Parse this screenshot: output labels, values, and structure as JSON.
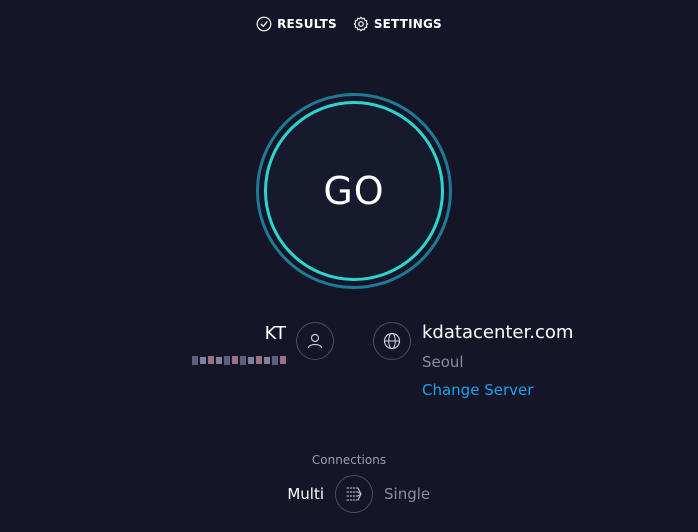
{
  "nav": {
    "results_label": "RESULTS",
    "settings_label": "SETTINGS"
  },
  "go_button": {
    "label": "GO"
  },
  "isp": {
    "name": "KT"
  },
  "server": {
    "name": "kdatacenter.com",
    "city": "Seoul",
    "change_label": "Change Server"
  },
  "connections": {
    "title": "Connections",
    "multi_label": "Multi",
    "single_label": "Single"
  },
  "icons": {
    "results": "check-circle-icon",
    "settings": "gear-icon",
    "user": "user-icon",
    "globe": "globe-icon",
    "connections": "connections-icon"
  },
  "colors": {
    "background": "#141526",
    "go_ring_outer": "#1e7a96",
    "go_ring_inner": "#2ad6d0",
    "link": "#1aa1f0"
  }
}
